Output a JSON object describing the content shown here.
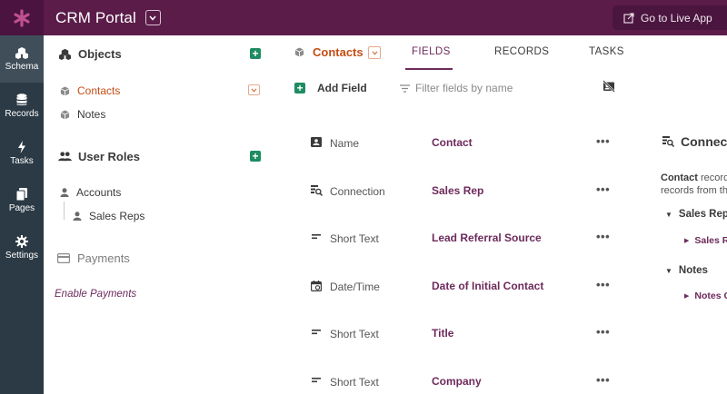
{
  "app": {
    "title": "CRM Portal",
    "live_button": "Go to Live App"
  },
  "rail": [
    {
      "label": "Schema",
      "icon": "schema-icon",
      "active": true
    },
    {
      "label": "Records",
      "icon": "database-icon"
    },
    {
      "label": "Tasks",
      "icon": "lightning-icon"
    },
    {
      "label": "Pages",
      "icon": "pages-icon"
    },
    {
      "label": "Settings",
      "icon": "gear-icon"
    }
  ],
  "objects_panel": {
    "objects_heading": "Objects",
    "objects": [
      {
        "label": "Contacts",
        "active": true
      },
      {
        "label": "Notes"
      }
    ],
    "roles_heading": "User Roles",
    "roles": [
      {
        "label": "Accounts"
      },
      {
        "label": "Sales Reps"
      }
    ],
    "payments_heading": "Payments",
    "enable_payments": "Enable Payments"
  },
  "main": {
    "object_name": "Contacts",
    "tabs": [
      "FIELDS",
      "RECORDS",
      "TASKS"
    ],
    "active_tab": "FIELDS",
    "add_field": "Add Field",
    "filter_placeholder": "Filter fields by name",
    "fields": [
      {
        "type": "Name",
        "icon": "id-card-icon",
        "name": "Contact"
      },
      {
        "type": "Connection",
        "icon": "connection-icon",
        "name": "Sales Rep"
      },
      {
        "type": "Short Text",
        "icon": "short-text-icon",
        "name": "Lead Referral Source"
      },
      {
        "type": "Date/Time",
        "icon": "calendar-icon",
        "name": "Date of Initial Contact"
      },
      {
        "type": "Short Text",
        "icon": "short-text-icon",
        "name": "Title"
      },
      {
        "type": "Short Text",
        "icon": "short-text-icon",
        "name": "Company"
      }
    ],
    "more_label": "•••"
  },
  "right_panel": {
    "title": "Connections",
    "desc_bold": "Contact",
    "desc_line1_rest": " records",
    "desc_line2": "records from th",
    "groups": [
      {
        "label": "Sales Reps",
        "child": "Sales Reps"
      },
      {
        "label": "Notes",
        "child": "Notes C"
      }
    ]
  },
  "colors": {
    "topbar": "#5b1c4a",
    "rail": "#2b3a45",
    "accent": "#6d2a5c",
    "active_object": "#c24e14",
    "add_green": "#1e8c63"
  }
}
